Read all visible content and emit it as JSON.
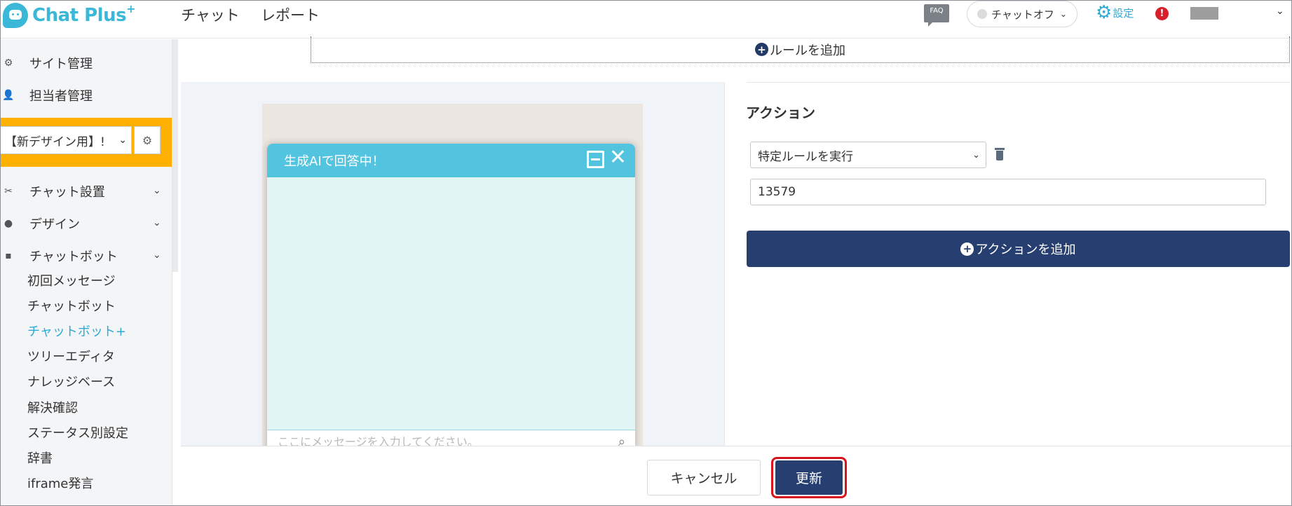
{
  "header": {
    "logo_text": "Chat Plus",
    "logo_sup": "+",
    "nav": [
      "チャット",
      "レポート"
    ],
    "faq": "FAQ",
    "chat_status": "チャットオフ",
    "settings_label": "設定",
    "alert": "!"
  },
  "sidebar": {
    "top_items": [
      {
        "label": "サイト管理",
        "icon": "gear-icon"
      },
      {
        "label": "担当者管理",
        "icon": "user-gear-icon"
      }
    ],
    "site_select_value": "【新デザイン用】!",
    "sections": [
      {
        "label": "チャット設置",
        "icon": "tools-icon"
      },
      {
        "label": "デザイン",
        "icon": "palette-icon"
      },
      {
        "label": "チャットボット",
        "icon": "chat-icon"
      }
    ],
    "sub_items": [
      "初回メッセージ",
      "チャットボット",
      "チャットボット+",
      "ツリーエディタ",
      "ナレッジベース",
      "解決確認",
      "ステータス別設定",
      "辞書",
      "iframe発言"
    ],
    "active_sub": "チャットボット+"
  },
  "main": {
    "add_rule": "ルールを追加",
    "widget_title": "生成AIで回答中！",
    "widget_placeholder": "ここにメッセージを入力してください。",
    "action_title": "アクション",
    "action_select": "特定ルールを実行",
    "action_value": "13579",
    "add_action": "アクションを追加"
  },
  "footer": {
    "cancel": "キャンセル",
    "update": "更新"
  },
  "colors": {
    "brand": "#3bb8d8",
    "navy": "#273f70",
    "highlight": "#ffb000",
    "alert": "#d8202a"
  }
}
